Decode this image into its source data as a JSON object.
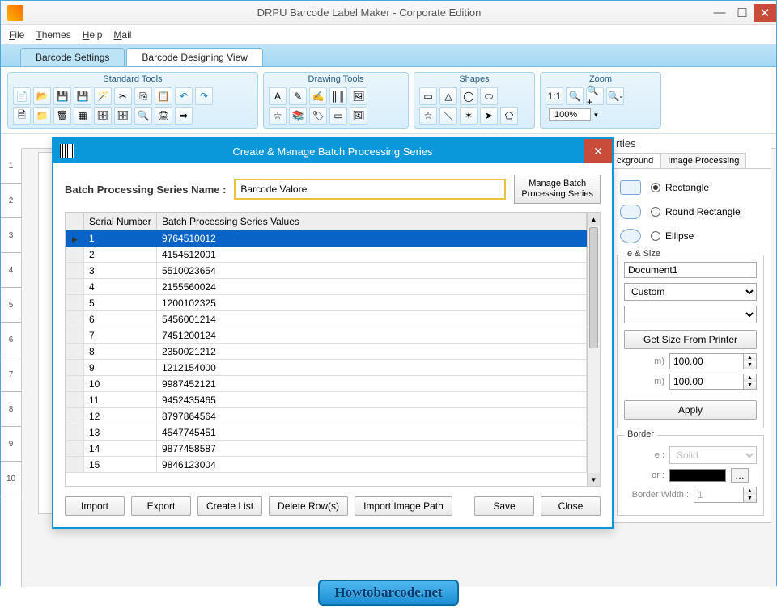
{
  "window": {
    "title": "DRPU Barcode Label Maker - Corporate Edition"
  },
  "menu": {
    "file": "File",
    "themes": "Themes",
    "help": "Help",
    "mail": "Mail"
  },
  "tabs": {
    "barcode_settings": "Barcode Settings",
    "designing_view": "Barcode Designing View"
  },
  "ribbon": {
    "standard": "Standard Tools",
    "drawing": "Drawing Tools",
    "shapes": "Shapes",
    "zoom": "Zoom",
    "zoom_value": "100%"
  },
  "ruler": [
    "1",
    "2",
    "3",
    "4",
    "5",
    "6",
    "7",
    "8",
    "9",
    "10"
  ],
  "right": {
    "title": "rties",
    "tabs": {
      "bg": "ckground",
      "imgproc": "Image Processing"
    },
    "shape_rect": "Rectangle",
    "shape_rrect": "Round Rectangle",
    "shape_ellipse": "Ellipse",
    "sizename": "e & Size",
    "doc_name": "Document1",
    "unit": "Custom",
    "get_size": "Get Size From Printer",
    "w_suffix": "m)",
    "h_suffix": "m)",
    "w": "100.00",
    "h": "100.00",
    "apply": "Apply",
    "border": "Border",
    "style_lbl": "e :",
    "style": "Solid",
    "color_lbl": "or :",
    "bw_lbl": "Border Width :",
    "bw": "1"
  },
  "dialog": {
    "title": "Create & Manage Batch Processing Series",
    "name_lbl": "Batch Processing Series Name :",
    "name_value": "Barcode Valore",
    "manage": "Manage  Batch\nProcessing Series",
    "col_serial": "Serial Number",
    "col_values": "Batch Processing Series Values",
    "rows": [
      {
        "n": "1",
        "v": "9764510012"
      },
      {
        "n": "2",
        "v": "4154512001"
      },
      {
        "n": "3",
        "v": "5510023654"
      },
      {
        "n": "4",
        "v": "2155560024"
      },
      {
        "n": "5",
        "v": "1200102325"
      },
      {
        "n": "6",
        "v": "5456001214"
      },
      {
        "n": "7",
        "v": "7451200124"
      },
      {
        "n": "8",
        "v": "2350021212"
      },
      {
        "n": "9",
        "v": "1212154000"
      },
      {
        "n": "10",
        "v": "9987452121"
      },
      {
        "n": "11",
        "v": "9452435465"
      },
      {
        "n": "12",
        "v": "8797864564"
      },
      {
        "n": "13",
        "v": "4547745451"
      },
      {
        "n": "14",
        "v": "9877458587"
      },
      {
        "n": "15",
        "v": "9846123004"
      }
    ],
    "btn_import": "Import",
    "btn_export": "Export",
    "btn_create": "Create List",
    "btn_delete": "Delete Row(s)",
    "btn_imgpath": "Import Image Path",
    "btn_save": "Save",
    "btn_close": "Close"
  },
  "footer": "Howtobarcode.net"
}
